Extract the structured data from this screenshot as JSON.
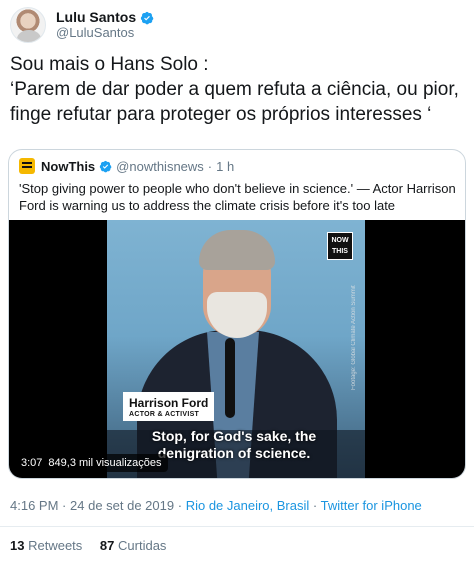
{
  "author": {
    "display_name": "Lulu Santos",
    "handle": "@LuluSantos"
  },
  "tweet": {
    "lines": [
      "Sou mais o Hans Solo :",
      "‘Parem de dar poder a quem refuta a ciência, ou pior,",
      "finge refutar para proteger os próprios interesses ‘"
    ]
  },
  "quoted": {
    "name": "NowThis",
    "handle": "@nowthisnews",
    "separator": "·",
    "age": "1 h",
    "text": "'Stop giving power to people who don't believe in science.' — Actor Harrison Ford is warning us to address the climate crisis before it's too late",
    "video": {
      "badge_line1": "NOW",
      "badge_line2": "THIS",
      "lower_third_name": "Harrison Ford",
      "lower_third_role": "ACTOR & ACTIVIST",
      "caption": "Stop, for God's sake, the denigration of science.",
      "footage_credit": "Footage: Global Climate Action Summit",
      "duration": "3:07",
      "views": "849,3 mil visualizações"
    }
  },
  "meta": {
    "time": "4:16 PM",
    "separator": "·",
    "date": "24 de set de 2019",
    "location": "Rio de Janeiro, Brasil",
    "source": "Twitter for iPhone"
  },
  "stats": {
    "retweets_count": "13",
    "retweets_label": "Retweets",
    "likes_count": "87",
    "likes_label": "Curtidas"
  },
  "colors": {
    "link": "#1b95e0",
    "verified": "#1da1f2",
    "muted": "#657786"
  }
}
